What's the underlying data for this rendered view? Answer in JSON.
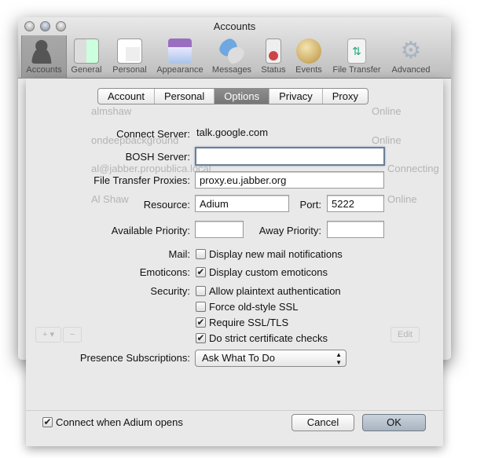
{
  "window": {
    "title": "Accounts"
  },
  "toolbar": [
    {
      "label": "Accounts",
      "icon": "accounts-icon",
      "selected": true
    },
    {
      "label": "General",
      "icon": "general-icon"
    },
    {
      "label": "Personal",
      "icon": "personal-card-icon"
    },
    {
      "label": "Appearance",
      "icon": "appearance-icon"
    },
    {
      "label": "Messages",
      "icon": "messages-bubbles-icon"
    },
    {
      "label": "Status",
      "icon": "status-door-hanger-icon"
    },
    {
      "label": "Events",
      "icon": "events-bell-icon"
    },
    {
      "label": "File Transfer",
      "icon": "file-transfer-icon"
    },
    {
      "label": "Advanced",
      "icon": "gear-icon"
    }
  ],
  "background_accounts": [
    {
      "name": "almshaw",
      "status": "Online"
    },
    {
      "name": "ondeepbackground",
      "status": "Online"
    },
    {
      "name": "al@jabber.propublica.local",
      "status": "Connecting"
    },
    {
      "name": "Al Shaw",
      "status": "Online"
    }
  ],
  "background_buttons": {
    "add": "+ ▾",
    "remove": "−",
    "edit": "Edit"
  },
  "tabs": [
    {
      "label": "Account"
    },
    {
      "label": "Personal"
    },
    {
      "label": "Options",
      "selected": true
    },
    {
      "label": "Privacy"
    },
    {
      "label": "Proxy"
    }
  ],
  "form": {
    "connect_server_label": "Connect Server:",
    "connect_server_value": "talk.google.com",
    "bosh_label": "BOSH Server:",
    "bosh_value": "",
    "ft_proxies_label": "File Transfer Proxies:",
    "ft_proxies_value": "proxy.eu.jabber.org",
    "resource_label": "Resource:",
    "resource_value": "Adium",
    "port_label": "Port:",
    "port_value": "5222",
    "avail_priority_label": "Available Priority:",
    "avail_priority_value": "",
    "away_priority_label": "Away Priority:",
    "away_priority_value": "",
    "mail_label": "Mail:",
    "emoticons_label": "Emoticons:",
    "security_label": "Security:",
    "checkboxes": [
      {
        "label": "Display new mail notifications",
        "checked": false
      },
      {
        "label": "Display custom emoticons",
        "checked": true
      },
      {
        "label": "Allow plaintext authentication",
        "checked": false
      },
      {
        "label": "Force old-style SSL",
        "checked": false
      },
      {
        "label": "Require SSL/TLS",
        "checked": true
      },
      {
        "label": "Do strict certificate checks",
        "checked": true
      }
    ],
    "presence_label": "Presence Subscriptions:",
    "presence_value": "Ask What To Do"
  },
  "footer": {
    "connect_label": "Connect when Adium opens",
    "connect_checked": true,
    "cancel": "Cancel",
    "ok": "OK"
  }
}
